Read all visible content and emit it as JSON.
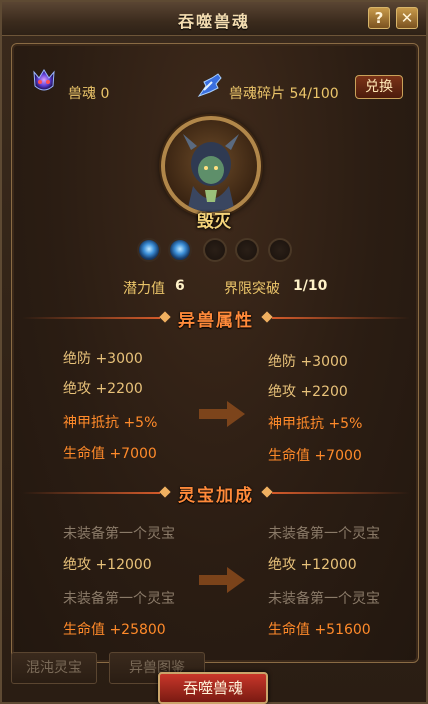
{
  "window": {
    "title": "吞噬兽魂",
    "help_label": "?",
    "close_label": "✕"
  },
  "header": {
    "soul_label": "兽魂 0",
    "fragment_label": "兽魂碎片 54/100",
    "exchange_label": "兑换"
  },
  "beast": {
    "name": "毁灭",
    "orbs_lit": 2,
    "orbs_total": 5
  },
  "stats": {
    "potential_label": "潜力值",
    "potential_value": "6",
    "limit_label": "界限突破",
    "limit_value": "1/10"
  },
  "sections": {
    "beast_attr_title": "异兽属性",
    "treasure_title": "灵宝加成"
  },
  "beast_attrs": {
    "current": [
      "绝防 +3000",
      "绝攻 +2200",
      "神甲抵抗 +5%",
      "生命值 +7000"
    ],
    "next": [
      "绝防 +3000",
      "绝攻 +2200",
      "神甲抵抗 +5%",
      "生命值 +7000"
    ]
  },
  "treasure_attrs": {
    "current": [
      "未装备第一个灵宝",
      "绝攻 +12000",
      "未装备第一个灵宝",
      "生命值 +25800"
    ],
    "next": [
      "未装备第一个灵宝",
      "绝攻 +12000",
      "未装备第一个灵宝",
      "生命值 +51600"
    ]
  },
  "bottom": {
    "tab1": "混沌灵宝",
    "tab2": "异兽图鉴",
    "devour_button": "吞噬兽魂"
  },
  "colors": {
    "accent_orange": "#ff8a2a",
    "gold_text": "#ebc56a",
    "muted_text": "#8a7a68"
  }
}
